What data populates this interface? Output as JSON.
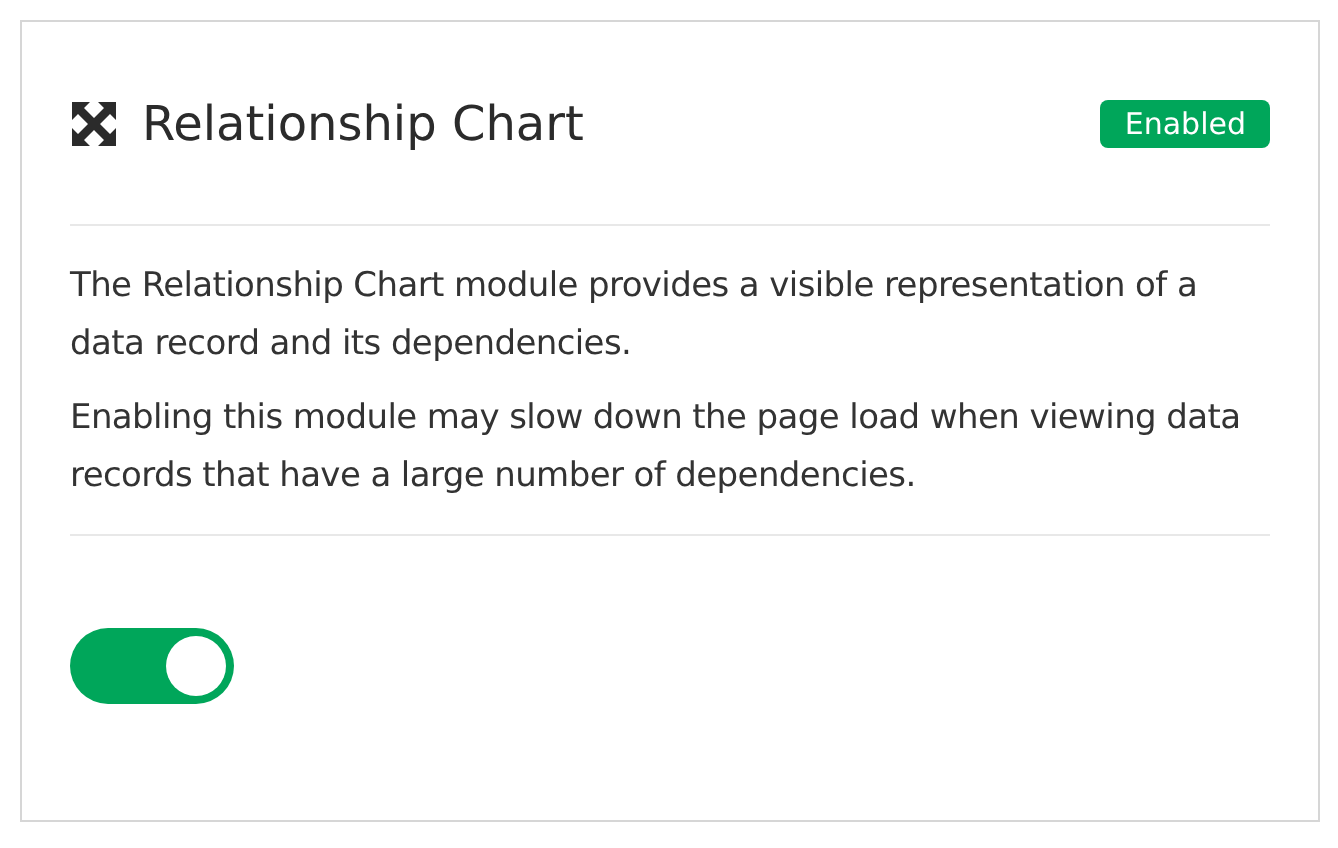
{
  "module": {
    "title": "Relationship Chart",
    "badge": "Enabled",
    "paragraphs": [
      "The Relationship Chart module provides a visible representation of a data record and its dependencies.",
      "Enabling this module may slow down the page load when viewing data records that have a large number of dependencies."
    ],
    "toggle": {
      "on": true
    }
  }
}
